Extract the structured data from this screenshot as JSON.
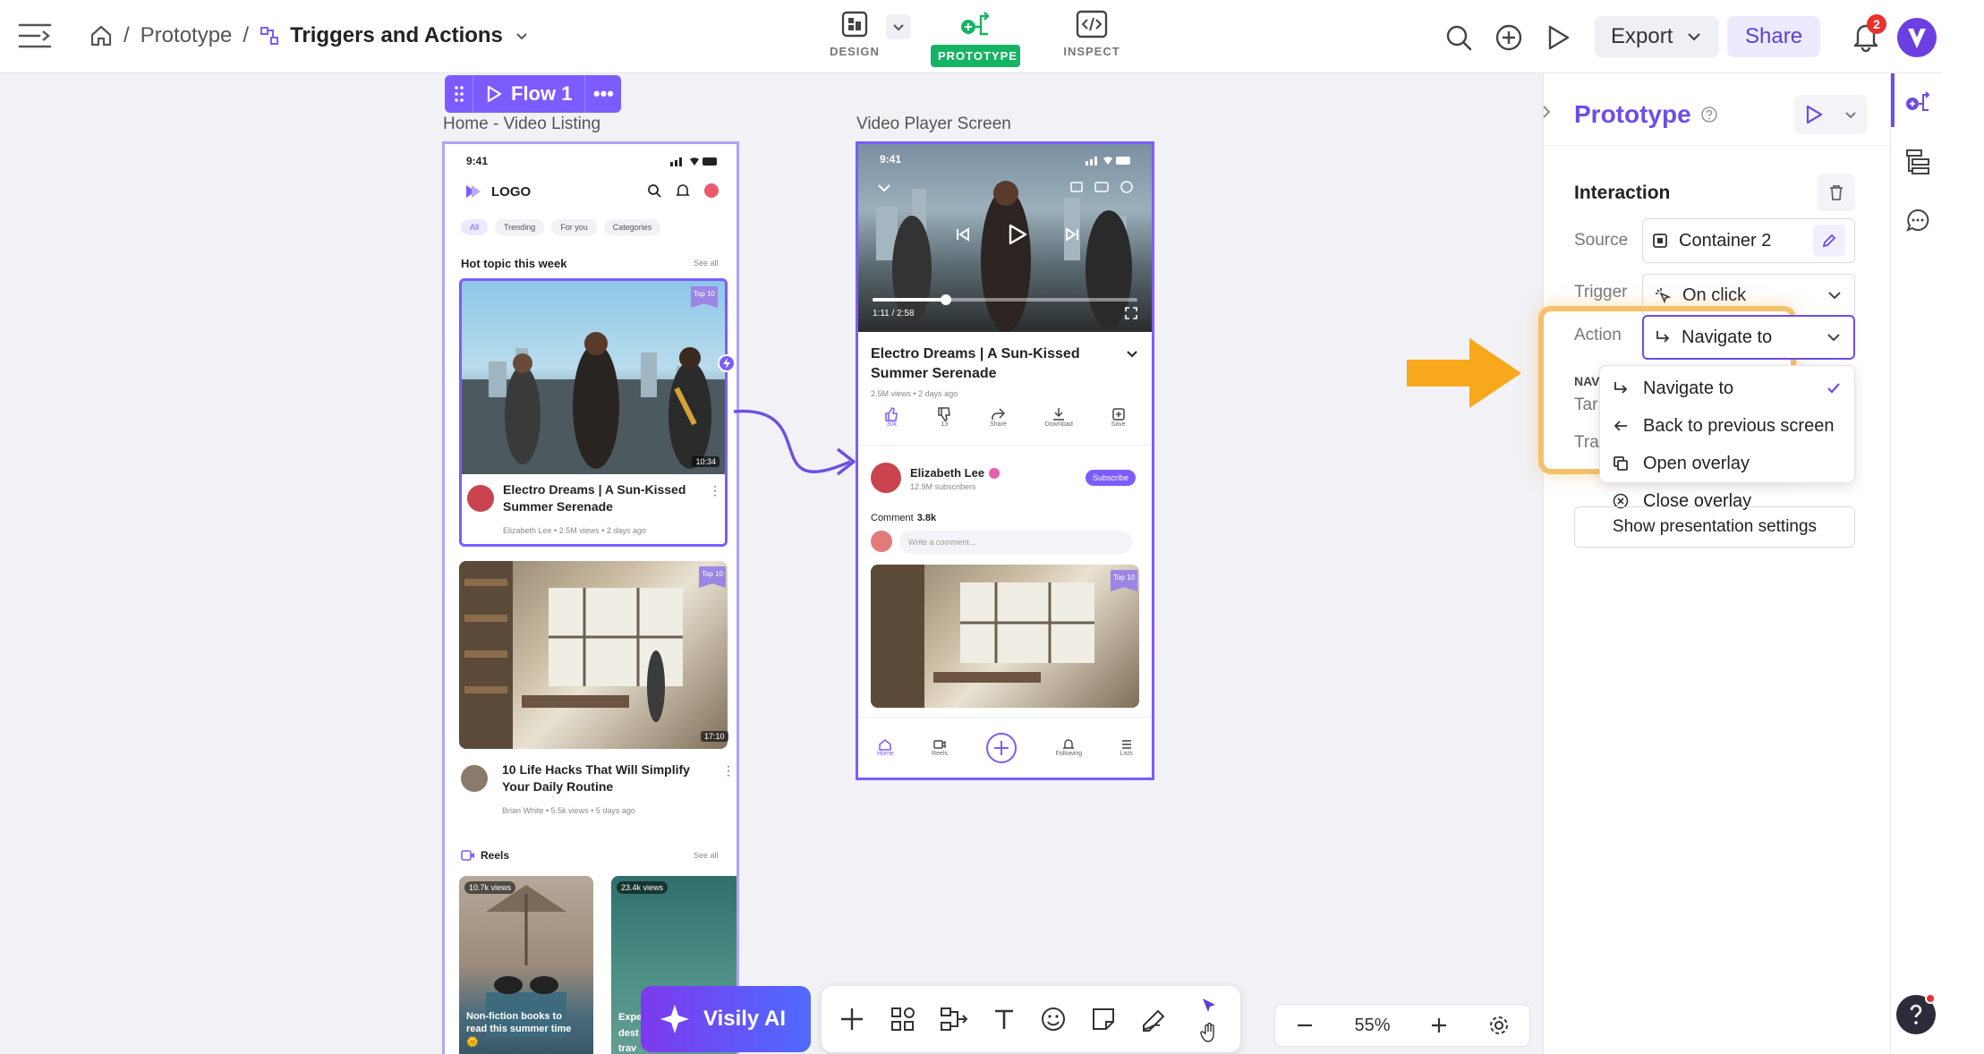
{
  "topbar": {
    "breadcrumb": [
      "Prototype",
      "Triggers and Actions"
    ],
    "modes": [
      {
        "label": "DESIGN",
        "icon": "design-icon",
        "active": false
      },
      {
        "label": "PROTOTYPE",
        "icon": "prototype-icon",
        "active": true
      },
      {
        "label": "INSPECT",
        "icon": "inspect-icon",
        "active": false
      }
    ],
    "export_label": "Export",
    "share_label": "Share",
    "notification_count": "2",
    "accent": "#7c5cff",
    "prototype_green": "#16b364"
  },
  "flow": {
    "label": "Flow 1"
  },
  "frames": {
    "home": {
      "title": "Home - Video Listing",
      "status_time": "9:41",
      "logo": "LOGO",
      "chips": [
        "All",
        "Trending",
        "For you",
        "Categories"
      ],
      "section_title": "Hot topic this week",
      "see_all": "See all",
      "card1": {
        "badge": "Top 10",
        "duration": "10:34",
        "title": "Electro Dreams | A Sun-Kissed Summer Serenade",
        "meta": "Elizabeth Lee • 2.5M views • 2 days ago"
      },
      "card2": {
        "badge": "Top 10",
        "duration": "17:10",
        "title": "10 Life Hacks That Will Simplify Your Daily Routine",
        "meta": "Brian White • 5.5k views • 5 days ago"
      },
      "reels_title": "Reels",
      "reels_see_all": "See all",
      "reel1": {
        "views": "10.7k views",
        "caption": "Non-fiction books to read this summer time 🌞"
      },
      "reel2": {
        "views": "23.4k views",
        "caption": "Expe dest trav"
      }
    },
    "player": {
      "title": "Video Player Screen",
      "status_time": "9:41",
      "progress_time": "1:11 / 2:58",
      "progress": 0.28,
      "video_title": "Electro Dreams | A Sun-Kissed Summer Serenade",
      "meta": "2.5M views • 2 days ago",
      "actions": [
        {
          "label": "30k",
          "icon": "thumbs-up-icon"
        },
        {
          "label": "13",
          "icon": "thumbs-down-icon"
        },
        {
          "label": "Share",
          "icon": "share-icon"
        },
        {
          "label": "Download",
          "icon": "download-icon"
        },
        {
          "label": "Save",
          "icon": "save-icon"
        }
      ],
      "channel_name": "Elizabeth Lee",
      "channel_subs": "12.9M subscribers",
      "subscribe_label": "Subscribe",
      "comment_label": "Comment",
      "comment_count": "3.8k",
      "comment_placeholder": "Write a comment...",
      "card_badge": "Top 10",
      "nav": [
        "Home",
        "Reels",
        "",
        "Following",
        "Lists"
      ]
    }
  },
  "toolbar": {
    "ai_label": "Visily AI",
    "tools": [
      "plus-icon",
      "components-icon",
      "flow-icon",
      "text-icon",
      "emoji-icon",
      "sticky-note-icon",
      "pen-icon"
    ]
  },
  "zoom": {
    "value": "55%"
  },
  "panel": {
    "title": "Prototype",
    "section": "Interaction",
    "source_label": "Source",
    "source_value": "Container 2",
    "trigger_label": "Trigger",
    "trigger_value": "On click",
    "action_label": "Action",
    "action_value": "Navigate to",
    "hidden_labels": [
      "NAV",
      "Tar",
      "Tra"
    ],
    "menu": [
      {
        "label": "Navigate to",
        "icon": "navigate-icon",
        "checked": true
      },
      {
        "label": "Back to previous screen",
        "icon": "arrow-left-icon",
        "checked": false
      },
      {
        "label": "Open overlay",
        "icon": "overlay-icon",
        "checked": false
      },
      {
        "label": "Close overlay",
        "icon": "close-circle-icon",
        "checked": false
      }
    ],
    "presentation_label": "Show presentation settings",
    "highlight_color": "#f5c06b",
    "arrow_color": "#f8a81c"
  }
}
